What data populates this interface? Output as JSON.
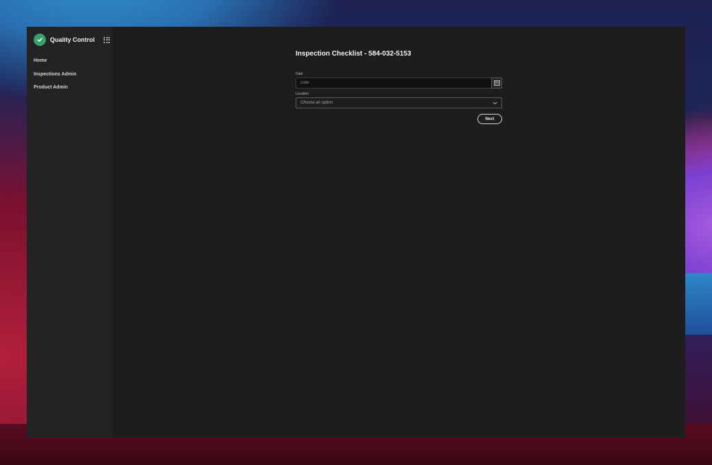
{
  "app": {
    "title": "Quality Control",
    "logo_icon": "check-circle-icon",
    "logo_color": "#3aa06a",
    "apps_icon": "grid-icon"
  },
  "sidebar": {
    "items": [
      {
        "label": "Home"
      },
      {
        "label": "Inspections Admin"
      },
      {
        "label": "Product Admin"
      }
    ]
  },
  "form": {
    "title": "Inspection Checklist - 584-032-5153",
    "date": {
      "label": "Date",
      "placeholder": "Date",
      "value": "",
      "icon": "calendar-icon"
    },
    "location": {
      "label": "Location",
      "selected": "Choose an option",
      "icon": "chevron-down-icon"
    },
    "next_label": "Next"
  }
}
